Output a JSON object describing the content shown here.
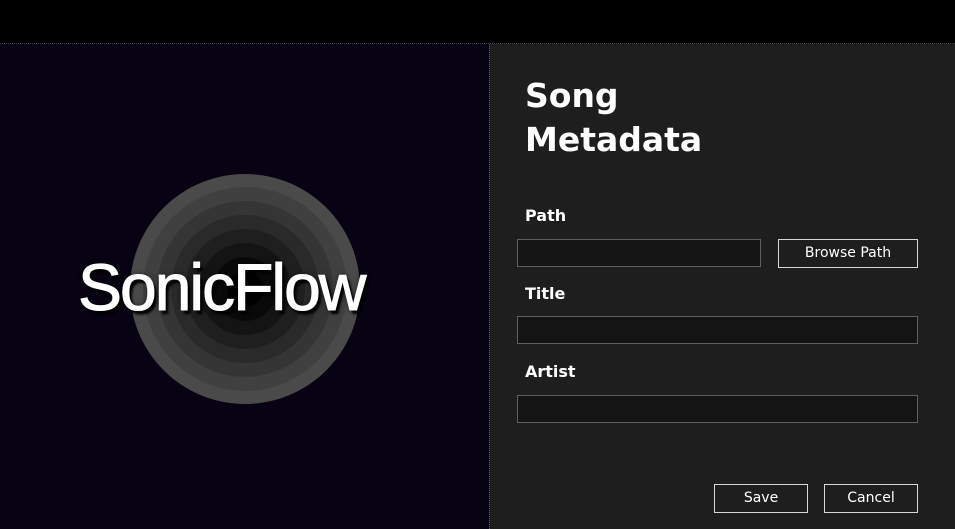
{
  "logo": {
    "text": "SonicFlow"
  },
  "form": {
    "heading_line1": "Song",
    "heading_line2": "Metadata",
    "path": {
      "label": "Path",
      "value": "",
      "browse_label": "Browse Path"
    },
    "title": {
      "label": "Title",
      "value": ""
    },
    "artist": {
      "label": "Artist",
      "value": ""
    },
    "save_label": "Save",
    "cancel_label": "Cancel"
  },
  "colors": {
    "left_background": "#070312",
    "right_background": "#1e1e1e",
    "input_background": "#141414",
    "button_border": "#d8d8d8",
    "text": "#ffffff"
  }
}
